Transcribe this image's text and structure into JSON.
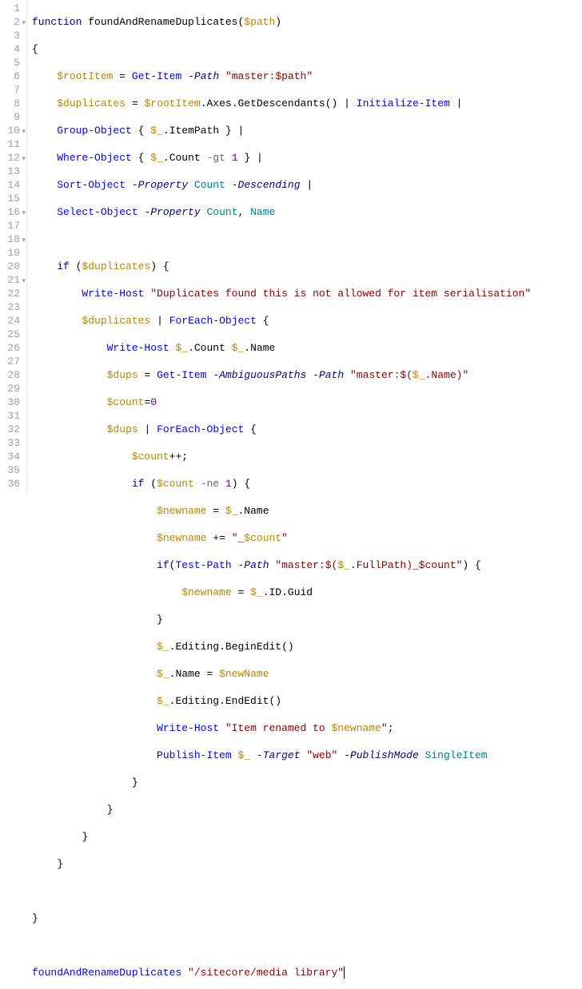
{
  "lineCount": 36,
  "foldLines": [
    2,
    10,
    12,
    16,
    18,
    21
  ],
  "tokens": {
    "l1": {
      "kw": "function",
      "name": "foundAndRenameDuplicates",
      "lp": "(",
      "var": "$path",
      "rp": ")"
    },
    "l2": {
      "brace": "{"
    },
    "l3": {
      "var": "$rootItem",
      "eq": "=",
      "cmd": "Get-Item",
      "p1": "-Path",
      "str": "\"master:$path\""
    },
    "l4": {
      "var": "$duplicates",
      "eq": "=",
      "v2": "$rootItem",
      "m1": ".Axes.GetDescendants()",
      "pipe": "|",
      "cmd": "Initialize-Item",
      "pipe2": "|"
    },
    "l5": {
      "cmd": "Group-Object",
      "lb": "{",
      "v": "$_",
      "m": ".ItemPath",
      "rb": "}",
      "pipe": "|"
    },
    "l6": {
      "cmd": "Where-Object",
      "lb": "{",
      "v": "$_",
      "m": ".Count",
      "op": "-gt",
      "n": "1",
      "rb": "}",
      "pipe": "|"
    },
    "l7": {
      "cmd": "Sort-Object",
      "p1": "-Property",
      "id1": "Count",
      "p2": "-Descending",
      "pipe": "|"
    },
    "l8": {
      "cmd": "Select-Object",
      "p1": "-Property",
      "id1": "Count",
      "c": ",",
      "id2": "Name"
    },
    "l10": {
      "kw": "if",
      "lp": "(",
      "var": "$duplicates",
      "rp": ")",
      "lb": "{"
    },
    "l11": {
      "cmd": "Write-Host",
      "str": "\"Duplicates found this is not allowed for item serialisation\""
    },
    "l12": {
      "var": "$duplicates",
      "pipe": "|",
      "cmd": "ForEach-Object",
      "lb": "{"
    },
    "l13": {
      "cmd": "Write-Host",
      "v": "$_",
      "m1": ".Count",
      "v2": "$_",
      "m2": ".Name"
    },
    "l14": {
      "var": "$dups",
      "eq": "=",
      "cmd": "Get-Item",
      "p1": "-AmbiguousPaths",
      "p2": "-Path",
      "s1": "\"master:",
      "sub": "$(",
      "v": "$_",
      "m": ".Name",
      "subr": ")",
      "s2": "\""
    },
    "l15": {
      "var": "$count",
      "eq": "=",
      "n": "0"
    },
    "l16": {
      "var": "$dups",
      "pipe": "|",
      "cmd": "ForEach-Object",
      "lb": "{"
    },
    "l17": {
      "var": "$count",
      "op": "++;"
    },
    "l18": {
      "kw": "if",
      "lp": "(",
      "var": "$count",
      "op": "-ne",
      "n": "1",
      "rp": ")",
      "lb": "{"
    },
    "l19": {
      "var": "$newname",
      "eq": "=",
      "v": "$_",
      "m": ".Name"
    },
    "l20": {
      "var": "$newname",
      "op": "+=",
      "s1": "\"_",
      "sv": "$count",
      "s2": "\""
    },
    "l21": {
      "kw": "if",
      "lp": "(",
      "cmd": "Test-Path",
      "p": "-Path",
      "s1": "\"master:",
      "sub": "$(",
      "v": "$_",
      "m": ".FullPath",
      "subr": ")",
      "sv": "_$count",
      "s2": "\"",
      "rp": ")",
      "lb": "{"
    },
    "l22": {
      "var": "$newname",
      "eq": "=",
      "v": "$_",
      "m": ".ID.Guid"
    },
    "l23": {
      "rb": "}"
    },
    "l24": {
      "v": "$_",
      "m": ".Editing.BeginEdit()"
    },
    "l25": {
      "v": "$_",
      "m": ".Name",
      "eq": "=",
      "var": "$newName"
    },
    "l26": {
      "v": "$_",
      "m": ".Editing.EndEdit()"
    },
    "l27": {
      "cmd": "Write-Host",
      "s1": "\"Item renamed to ",
      "sv": "$newname",
      "s2": "\"",
      "sc": ";"
    },
    "l28": {
      "cmd": "Publish-Item",
      "v": "$_",
      "p1": "-Target",
      "str": "\"web\"",
      "p2": "-PublishMode",
      "id": "SingleItem"
    },
    "l29": {
      "rb": "}"
    },
    "l30": {
      "rb": "}"
    },
    "l31": {
      "rb": "}"
    },
    "l32": {
      "rb": "}"
    },
    "l34": {
      "rb": "}"
    },
    "l36": {
      "name": "foundAndRenameDuplicates",
      "str": "\"/sitecore/media library\""
    }
  }
}
